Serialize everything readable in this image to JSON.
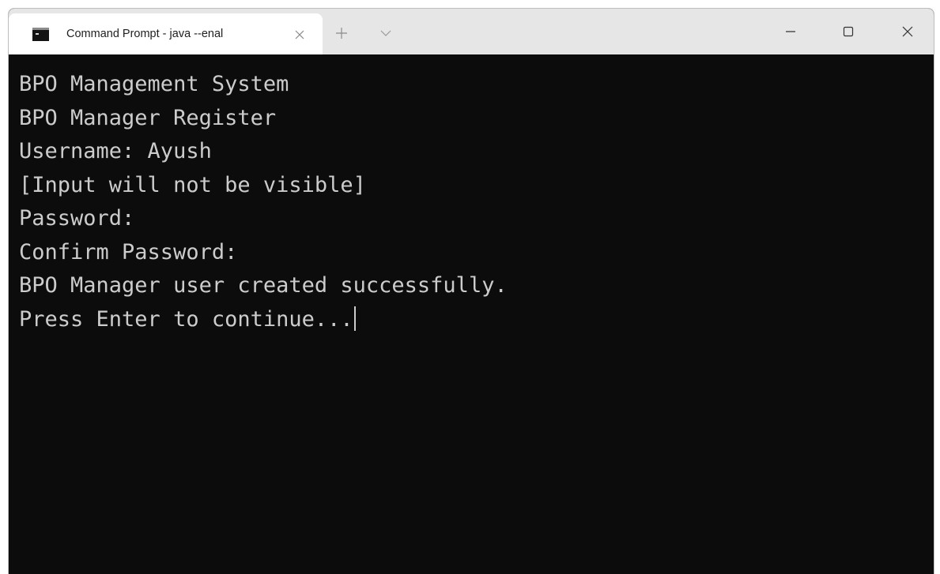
{
  "window": {
    "tab_title": "Command Prompt - java --enal",
    "tab_icon": "terminal-icon"
  },
  "titlebar_buttons": {
    "new_tab_icon": "plus-icon",
    "dropdown_icon": "chevron-down-icon",
    "minimize_icon": "minimize-icon",
    "maximize_icon": "maximize-icon",
    "close_icon": "close-icon"
  },
  "console": {
    "lines": [
      "BPO Management System",
      "BPO Manager Register",
      "Username: Ayush",
      "[Input will not be visible]",
      "Password:",
      "Confirm Password:",
      "BPO Manager user created successfully.",
      "Press Enter to continue..."
    ]
  },
  "colors": {
    "console_background": "#0c0c0c",
    "console_text": "#cccccc",
    "titlebar_background": "#e6e6e6",
    "tab_background": "#ffffff"
  }
}
